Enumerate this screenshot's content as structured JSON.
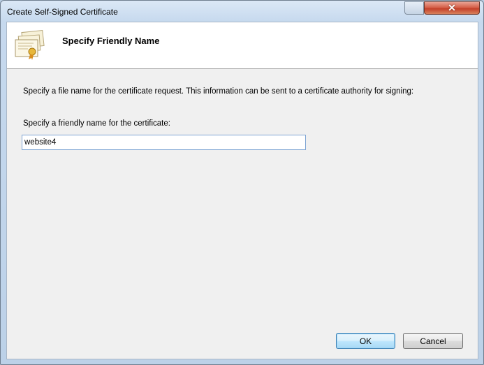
{
  "window": {
    "title": "Create Self-Signed Certificate",
    "close_label": "✕"
  },
  "header": {
    "title": "Specify Friendly Name",
    "icon": "certificate-icon"
  },
  "content": {
    "description": "Specify a file name for the certificate request.  This information can be sent to a certificate authority for signing:",
    "friendly_name_label": "Specify a friendly name for the certificate:",
    "friendly_name_value": "website4"
  },
  "buttons": {
    "ok_label": "OK",
    "cancel_label": "Cancel"
  },
  "colors": {
    "accent": "#3c7fb1",
    "close": "#c4402a",
    "frame": "#c6d9ee"
  }
}
